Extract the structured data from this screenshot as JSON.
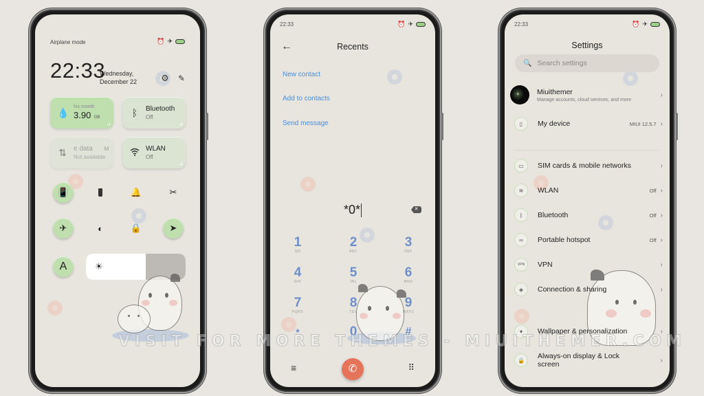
{
  "watermark": "VISIT FOR MORE THEMES - MIUITHEMER.COM",
  "status": {
    "time": "22:33",
    "battery_color": "#9fd08a"
  },
  "control_center": {
    "label": "Airplane mode",
    "time": "22:33",
    "date_line1": "Wednesday,",
    "date_line2": "December 22",
    "tiles": [
      {
        "id": "data-usage",
        "small": "his month",
        "value": "3.90",
        "unit": "GB",
        "active": true,
        "icon": "water-drop-icon"
      },
      {
        "id": "bluetooth",
        "title": "Bluetooth",
        "sub": "Off",
        "active": false,
        "icon": "bluetooth-icon"
      },
      {
        "id": "mobile-data",
        "title": "e data",
        "extra": "M",
        "sub": "Not available",
        "active": false,
        "disabled": true,
        "icon": "data-arrows-icon"
      },
      {
        "id": "wlan",
        "title": "WLAN",
        "sub": "Off",
        "active": false,
        "icon": "wifi-icon"
      }
    ],
    "toggles": [
      {
        "name": "vibrate",
        "icon": "vibrate-icon",
        "on": true
      },
      {
        "name": "flashlight",
        "icon": "flashlight-icon",
        "on": false
      },
      {
        "name": "sound",
        "icon": "bell-icon",
        "on": false
      },
      {
        "name": "screenshot",
        "icon": "scissors-icon",
        "on": false
      },
      {
        "name": "airplane",
        "icon": "airplane-icon",
        "on": true
      },
      {
        "name": "dark-mode",
        "icon": "contrast-icon",
        "on": false
      },
      {
        "name": "lock-screen",
        "icon": "lock-icon",
        "on": false
      },
      {
        "name": "location",
        "icon": "location-arrow-icon",
        "on": true
      },
      {
        "name": "auto-brightness",
        "icon": "letter-a-icon",
        "on": true
      }
    ],
    "brightness_percent": 60,
    "accent": "#bfe0ae"
  },
  "dialer": {
    "title": "Recents",
    "links": [
      "New contact",
      "Add to contacts",
      "Send message"
    ],
    "input": "*0*",
    "keys": [
      {
        "num": "1",
        "letters": "QO"
      },
      {
        "num": "2",
        "letters": "ABC"
      },
      {
        "num": "3",
        "letters": "DEF"
      },
      {
        "num": "4",
        "letters": "GHI"
      },
      {
        "num": "5",
        "letters": "JKL"
      },
      {
        "num": "6",
        "letters": "MNO"
      },
      {
        "num": "7",
        "letters": "PQRS"
      },
      {
        "num": "8",
        "letters": "TUV"
      },
      {
        "num": "9",
        "letters": "WXYZ"
      },
      {
        "num": "*",
        "letters": ""
      },
      {
        "num": "0",
        "letters": ""
      },
      {
        "num": "#",
        "letters": ""
      }
    ],
    "call_color": "#e6745b",
    "link_color": "#4a8fdc"
  },
  "settings": {
    "title": "Settings",
    "search_placeholder": "Search settings",
    "account": {
      "name": "Miuithemer",
      "sub": "Manage accounts, cloud services, and more"
    },
    "rows": [
      {
        "label": "My device",
        "value": "MIUI 12.5.7",
        "icon": "phone-icon"
      },
      {
        "label": "SIM cards & mobile networks",
        "value": "",
        "icon": "sim-card-icon"
      },
      {
        "label": "WLAN",
        "value": "Off",
        "icon": "wifi-icon"
      },
      {
        "label": "Bluetooth",
        "value": "Off",
        "icon": "bluetooth-icon"
      },
      {
        "label": "Portable hotspot",
        "value": "Off",
        "icon": "hotspot-icon"
      },
      {
        "label": "VPN",
        "value": "",
        "icon": "vpn-icon"
      },
      {
        "label": "Connection & sharing",
        "value": "",
        "icon": "connection-icon"
      },
      {
        "label": "Wallpaper & personalization",
        "value": "",
        "icon": "wallpaper-icon"
      },
      {
        "label": "Always-on display & Lock screen",
        "value": "",
        "icon": "lock-icon"
      }
    ]
  }
}
